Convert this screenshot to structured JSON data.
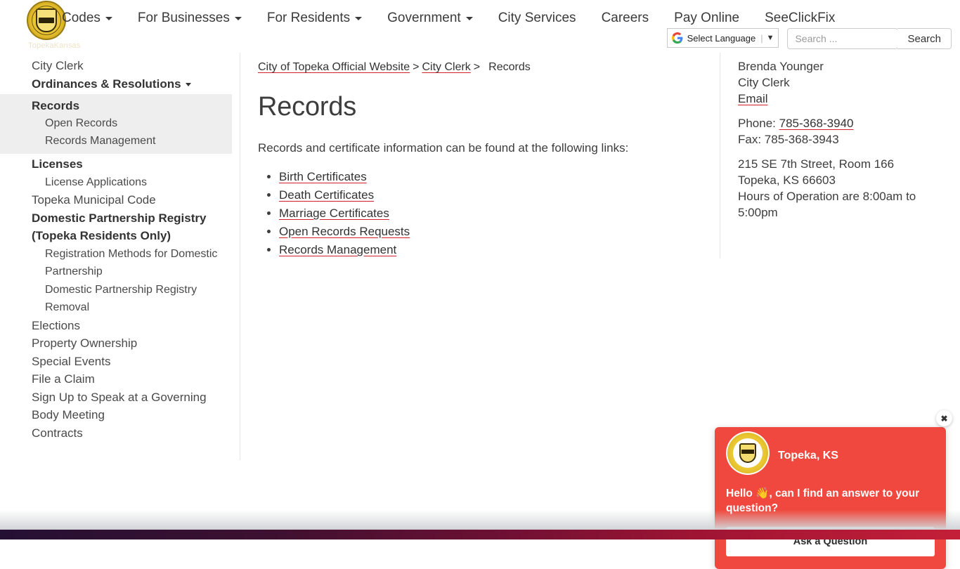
{
  "brand": {
    "logo_alt": "City of Topeka Seal",
    "logo_sub_first": "Topeka",
    "logo_sub_second": "Kansas"
  },
  "topnav": {
    "items": [
      {
        "label": "Codes",
        "has_caret": true
      },
      {
        "label": "For Businesses",
        "has_caret": true
      },
      {
        "label": "For Residents",
        "has_caret": true
      },
      {
        "label": "Government",
        "has_caret": true
      },
      {
        "label": "City Services",
        "has_caret": false
      },
      {
        "label": "Careers",
        "has_caret": false
      },
      {
        "label": "Pay Online",
        "has_caret": false
      },
      {
        "label": "SeeClickFix",
        "has_caret": false
      }
    ]
  },
  "tools": {
    "translate_label": "Select Language",
    "translate_caret": "▼",
    "search_placeholder": "Search ...",
    "search_value": "",
    "search_button": "Search"
  },
  "sidebar": {
    "items": [
      {
        "label": "City Clerk",
        "level": 1,
        "bold": false,
        "caret": false,
        "highlight": false
      },
      {
        "label": "Ordinances & Resolutions",
        "level": 1,
        "bold": true,
        "caret": true,
        "highlight": false
      },
      {
        "label": "Records",
        "level": 1,
        "bold": true,
        "caret": false,
        "highlight": true
      },
      {
        "label": "Open Records",
        "level": 2,
        "bold": false,
        "caret": false,
        "highlight": true
      },
      {
        "label": "Records Management",
        "level": 2,
        "bold": false,
        "caret": false,
        "highlight": true
      },
      {
        "label": "Licenses",
        "level": 1,
        "bold": true,
        "caret": false,
        "highlight": false
      },
      {
        "label": "License Applications",
        "level": 2,
        "bold": false,
        "caret": false,
        "highlight": false
      },
      {
        "label": "Topeka Municipal Code",
        "level": 1,
        "bold": false,
        "caret": false,
        "highlight": false
      },
      {
        "label": "Domestic Partnership Registry (Topeka Residents Only)",
        "level": 1,
        "bold": true,
        "caret": false,
        "highlight": false
      },
      {
        "label": "Registration Methods for Domestic Partnership",
        "level": 2,
        "bold": false,
        "caret": false,
        "highlight": false
      },
      {
        "label": "Domestic Partnership Registry Removal",
        "level": 2,
        "bold": false,
        "caret": false,
        "highlight": false
      },
      {
        "label": "Elections",
        "level": 1,
        "bold": false,
        "caret": false,
        "highlight": false
      },
      {
        "label": "Property Ownership",
        "level": 1,
        "bold": false,
        "caret": false,
        "highlight": false
      },
      {
        "label": "Special Events",
        "level": 1,
        "bold": false,
        "caret": false,
        "highlight": false
      },
      {
        "label": "File a Claim",
        "level": 1,
        "bold": false,
        "caret": false,
        "highlight": false
      },
      {
        "label": "Sign Up to Speak at a Governing Body Meeting",
        "level": 1,
        "bold": false,
        "caret": false,
        "highlight": false
      },
      {
        "label": "Contracts",
        "level": 1,
        "bold": false,
        "caret": false,
        "highlight": false
      }
    ]
  },
  "breadcrumb": {
    "home": "City of Topeka Official Website",
    "sep1": ">",
    "parent": "City Clerk",
    "sep2": ">",
    "current": "Records"
  },
  "main": {
    "title": "Records",
    "intro": "Records and certificate information can be found at the following links:",
    "links": [
      "Birth Certificates",
      "Death Certificates",
      "Marriage Certificates",
      "Open Records Requests",
      "Records Management"
    ]
  },
  "contact": {
    "name": "Brenda Younger",
    "role": "City Clerk",
    "email_label": "Email",
    "phone_label": "Phone:",
    "phone": "785-368-3940",
    "fax_line": "Fax: 785-368-3943",
    "address_line1": "215 SE 7th Street, Room 166",
    "address_line2": "Topeka, KS 66603",
    "hours": "Hours of Operation are 8:00am to 5:00pm"
  },
  "chat": {
    "title": "Topeka, KS",
    "message": "Hello 👋, can I find an answer to your question?",
    "button": "Ask a Question",
    "close_glyph": "✖",
    "accent_color": "#f0483e"
  },
  "colors": {
    "link_underline": "#d0202e",
    "highlight_bg": "#eeeeee",
    "footer_gradient_start": "#241033",
    "footer_gradient_end": "#c41f38"
  }
}
